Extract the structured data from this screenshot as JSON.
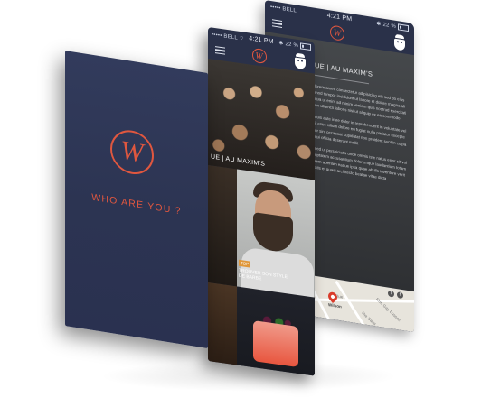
{
  "status_bar": {
    "carrier": "BELL",
    "signal": "•••••",
    "time": "4:21 PM",
    "battery": "22 %"
  },
  "icons": {
    "menu": "hamburger-icon",
    "brand": "w-logo-icon",
    "profile": "bearded-man-icon",
    "wifi": "wifi-icon",
    "bluetooth": "bluetooth-icon",
    "twitter": "twitter-icon",
    "facebook": "facebook-icon",
    "map_pin": "map-pin-icon"
  },
  "colors": {
    "accent": "#e0573f",
    "phone_bg": "#2c3452",
    "tag": "#e0973a"
  },
  "splash": {
    "logo_letter": "W",
    "tagline": "WHO ARE YOU ?"
  },
  "feed": {
    "headline_1": "UE | AU MAXIM'S",
    "tag": "TOP",
    "headline_2": "TROUVER SON STYLE DE BARBE"
  },
  "article": {
    "title": "UE | AU MAXIM'S",
    "paragraph_1": "lorem amet, consectetur adipisicing elit sed do eiusmod tempor incididunt ut labore et dolore magna aliqua ut enim ad minim veniam quis nostrud exercitation ullamco laboris nisi ut aliquip ex ea commodo",
    "paragraph_2": "duis aute irure dolor in reprehenderit in voluptate velit esse cillum dolore eu fugiat nulla pariatur excepteur sint occaecat cupidatat non proident sunt in culpa qui officia deserunt mollit",
    "paragraph_3": "sed ut perspiciatis unde omnis iste natus error sit voluptatem accusantium doloremque laudantium totam rem aperiam eaque ipsa quae ab illo inventore veritatis et quasi architecto beatae vitae dicta",
    "map_labels": [
      "Rue",
      "Wilson",
      "Rue Gay Lussac",
      "The Saint"
    ]
  }
}
